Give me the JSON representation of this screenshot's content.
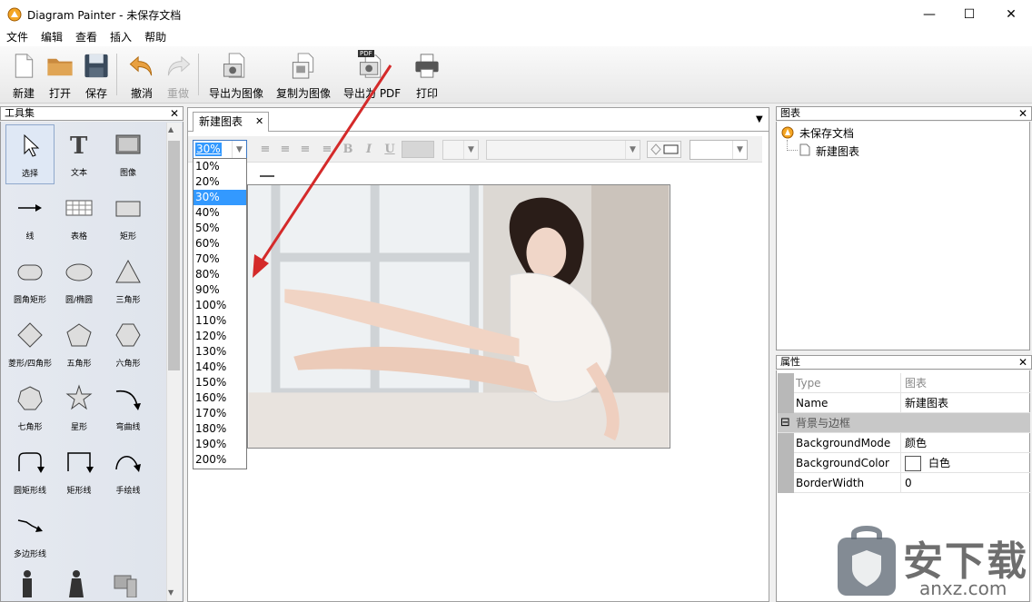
{
  "window": {
    "title": "Diagram Painter - 未保存文档",
    "minimize": "—",
    "maximize": "☐",
    "close": "✕"
  },
  "menu": [
    "文件",
    "编辑",
    "查看",
    "插入",
    "帮助"
  ],
  "toolbar": {
    "new": "新建",
    "open": "打开",
    "save": "保存",
    "undo": "撤消",
    "redo": "重做",
    "export_image": "导出为图像",
    "copy_image": "复制为图像",
    "export_pdf": "导出为 PDF",
    "print": "打印",
    "pdf_badge": "PDF"
  },
  "toolbox": {
    "title": "工具集",
    "close": "✕",
    "tools": [
      "选择",
      "文本",
      "图像",
      "线",
      "表格",
      "矩形",
      "圆角矩形",
      "圆/椭圆",
      "三角形",
      "菱形/四角形",
      "五角形",
      "六角形",
      "七角形",
      "星形",
      "弯曲线",
      "圆矩形线",
      "矩形线",
      "手绘线",
      "多边形线"
    ]
  },
  "document": {
    "tab_label": "新建图表",
    "tab_close": "✕",
    "tab_menu": "▼",
    "zoom": "30%",
    "zoom_options": [
      "10%",
      "20%",
      "30%",
      "40%",
      "50%",
      "60%",
      "70%",
      "80%",
      "90%",
      "100%",
      "110%",
      "120%",
      "130%",
      "140%",
      "150%",
      "160%",
      "170%",
      "180%",
      "190%",
      "200%"
    ],
    "format_buttons": {
      "bold": "B",
      "italic": "I",
      "underline": "U"
    }
  },
  "chart_panel": {
    "title": "图表",
    "close": "✕",
    "tree_root": "未保存文档",
    "tree_child": "新建图表"
  },
  "properties_panel": {
    "title": "属性",
    "close": "✕",
    "rows": [
      {
        "key": "Type",
        "value": "图表"
      },
      {
        "key": "Name",
        "value": "新建图表"
      }
    ],
    "category": "背景与边框",
    "category_toggle": "⊟",
    "rows2": [
      {
        "key": "BackgroundMode",
        "value": "颜色"
      },
      {
        "key": "BackgroundColor",
        "value": "白色"
      },
      {
        "key": "BorderWidth",
        "value": "0"
      }
    ]
  },
  "watermark": {
    "text": "安下载",
    "url": "anxz.com"
  },
  "colors": {
    "selection": "#3399ff",
    "arrow": "#d42a2a"
  }
}
